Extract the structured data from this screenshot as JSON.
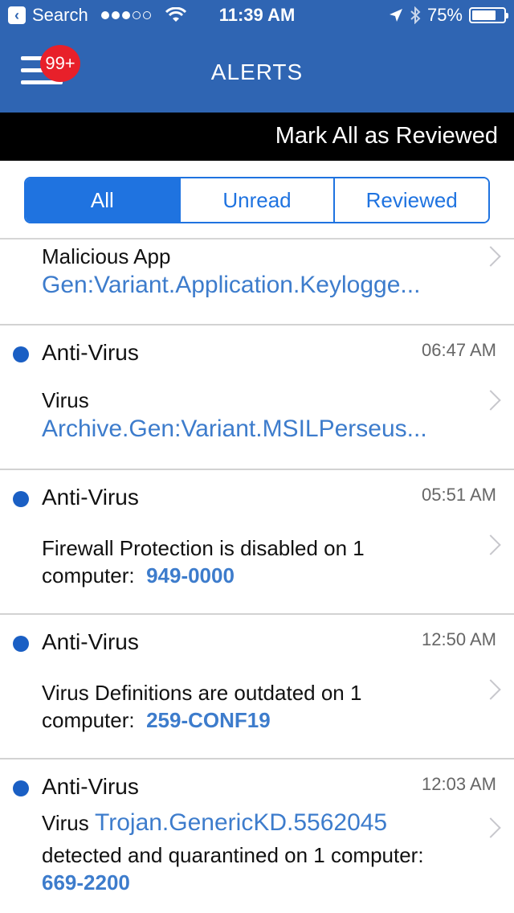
{
  "status_bar": {
    "back_label": "Search",
    "time": "11:39 AM",
    "battery": "75%",
    "battery_level": 0.75,
    "signal_bars_filled": 3,
    "signal_bars_total": 5
  },
  "nav": {
    "title": "ALERTS",
    "badge": "99+"
  },
  "actions": {
    "mark_all": "Mark All as Reviewed"
  },
  "tabs": [
    {
      "label": "All",
      "active": true
    },
    {
      "label": "Unread",
      "active": false
    },
    {
      "label": "Reviewed",
      "active": false
    }
  ],
  "alerts": [
    {
      "category_line": "Malicious App",
      "detail": "Gen:Variant.Application.Keylogge..."
    },
    {
      "title": "Anti-Virus",
      "time": "06:47 AM",
      "category_line": "Virus",
      "detail": "Archive.Gen:Variant.MSILPerseus..."
    },
    {
      "title": "Anti-Virus",
      "time": "05:51 AM",
      "line1": "Firewall Protection is disabled on 1",
      "line2_prefix": "computer:",
      "computer": "949-0000"
    },
    {
      "title": "Anti-Virus",
      "time": "12:50 AM",
      "line1": "Virus Definitions are outdated on 1",
      "line2_prefix": "computer:",
      "computer": "259-CONF19"
    },
    {
      "title": "Anti-Virus",
      "time": "12:03 AM",
      "line1_prefix": "Virus",
      "threat": "Trojan.GenericKD.5562045",
      "line2": "detected and quarantined on 1 computer:",
      "computer": "669-2200"
    }
  ],
  "colors": {
    "header": "#2f65b3",
    "accent": "#1f73e0",
    "link": "#3d7ccc",
    "badge": "#e8202a",
    "unread_dot": "#1a5fc4"
  }
}
